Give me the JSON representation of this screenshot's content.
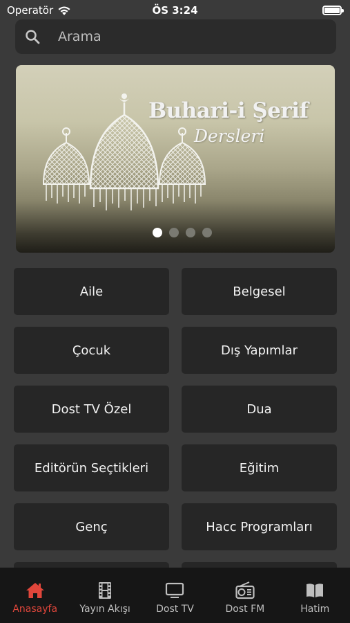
{
  "status_bar": {
    "carrier": "Operatör",
    "time": "ÖS 3:24"
  },
  "search": {
    "placeholder": "Arama"
  },
  "banner": {
    "title": "Buhari-i Şerif",
    "subtitle": "Dersleri",
    "page_count": 4,
    "active_page": 1
  },
  "categories": [
    "Aile",
    "Belgesel",
    "Çocuk",
    "Dış Yapımlar",
    "Dost TV Özel",
    "Dua",
    "Editörün Seçtikleri",
    "Eğitim",
    "Genç",
    "Hacc Programları"
  ],
  "tabs": [
    {
      "label": "Anasayfa",
      "icon": "home-icon",
      "active": true
    },
    {
      "label": "Yayın Akışı",
      "icon": "film-icon",
      "active": false
    },
    {
      "label": "Dost TV",
      "icon": "tv-icon",
      "active": false
    },
    {
      "label": "Dost FM",
      "icon": "radio-icon",
      "active": false
    },
    {
      "label": "Hatim",
      "icon": "book-icon",
      "active": false
    }
  ],
  "colors": {
    "accent": "#e0463b",
    "background": "#3a3a3a",
    "tile": "#262626",
    "tabbar": "#161616"
  }
}
